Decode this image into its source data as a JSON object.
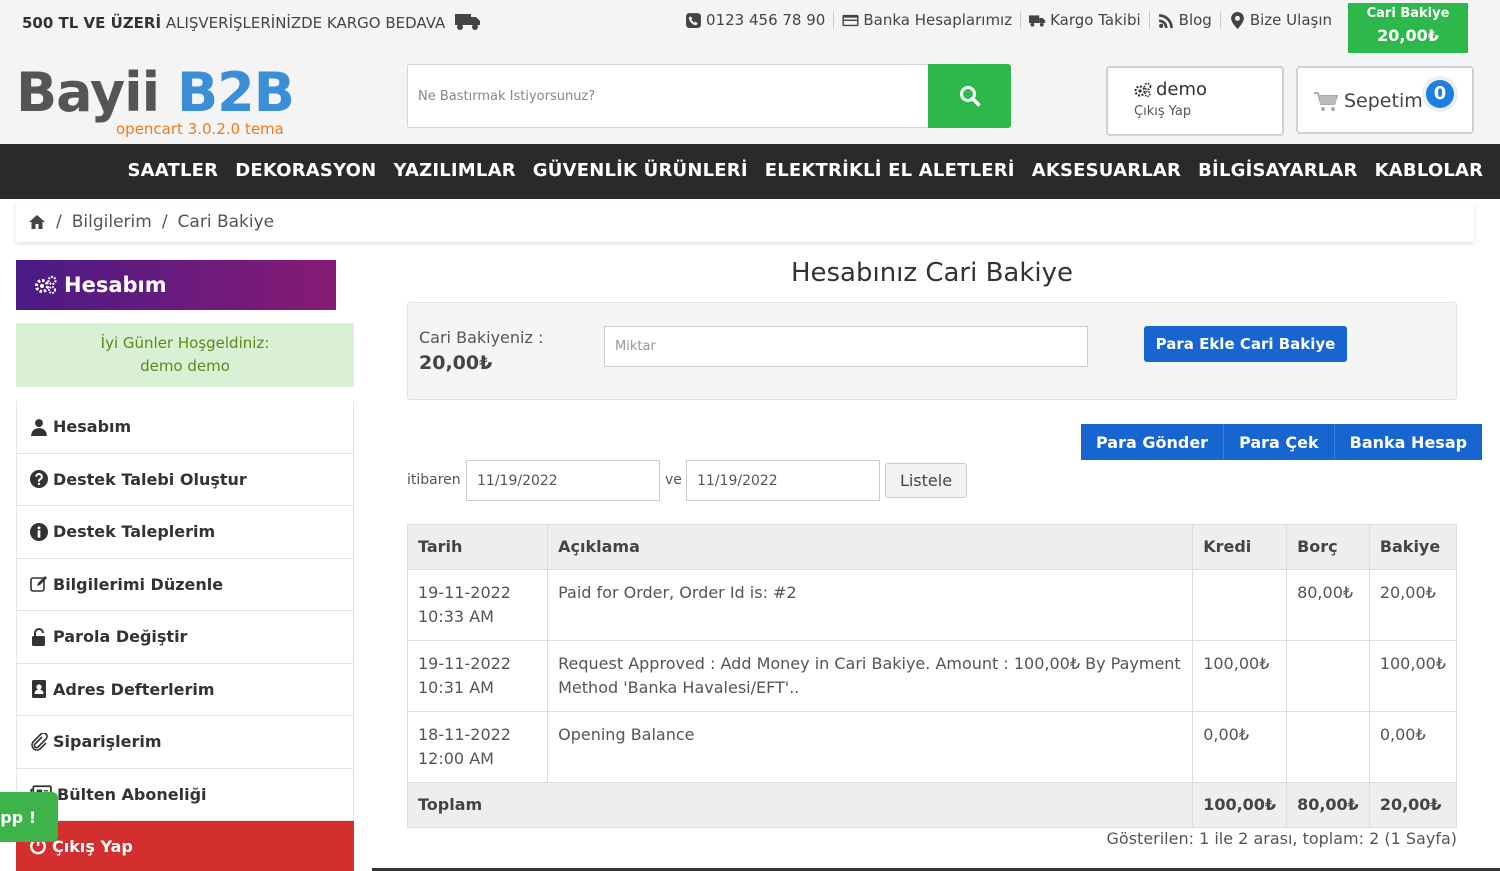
{
  "topbar": {
    "promo_bold": "500 TL VE ÜZERİ",
    "promo_rest": "ALIŞVERİŞLERİNİZDE KARGO BEDAVA",
    "links": [
      {
        "icon": "phone-icon",
        "label": "0123 456 78 90"
      },
      {
        "icon": "credit-card-icon",
        "label": "Banka Hesaplarımız"
      },
      {
        "icon": "truck-icon",
        "label": "Kargo Takibi"
      },
      {
        "icon": "rss-icon",
        "label": "Blog"
      },
      {
        "icon": "map-pin-icon",
        "label": "Bize Ulaşın"
      }
    ],
    "cari_bakiye_label": "Cari Bakiye",
    "cari_bakiye_value": "20,00₺"
  },
  "header": {
    "logo_main": "Bayii",
    "logo_accent": "B2B",
    "logo_sub": "opencart 3.0.2.0 tema",
    "search_placeholder": "Ne Bastırmak İstiyorsunuz?",
    "user_name": "demo",
    "user_logout": "Çıkış Yap",
    "cart_label": "Sepetim",
    "cart_count": "0"
  },
  "nav": [
    "SAATLER",
    "DEKORASYON",
    "YAZILIMLAR",
    "GÜVENLİK ÜRÜNLERİ",
    "ELEKTRİKLİ EL ALETLERİ",
    "AKSESUARLAR",
    "BİLGİSAYARLAR",
    "KABLOLAR"
  ],
  "breadcrumb": [
    "Bilgilerim",
    "Cari Bakiye"
  ],
  "sidebar": {
    "title": "Hesabım",
    "welcome_line1": "İyi Günler Hoşgeldiniz:",
    "welcome_line2": "demo demo",
    "items": [
      {
        "icon": "user-icon",
        "label": "Hesabım"
      },
      {
        "icon": "question-circle-icon",
        "label": "Destek Talebi Oluştur"
      },
      {
        "icon": "info-circle-icon",
        "label": "Destek Taleplerim"
      },
      {
        "icon": "edit-icon",
        "label": "Bilgilerimi Düzenle"
      },
      {
        "icon": "unlock-icon",
        "label": "Parola Değiştir"
      },
      {
        "icon": "address-book-icon",
        "label": "Adres Defterlerim"
      },
      {
        "icon": "paperclip-icon",
        "label": "Siparişlerim"
      },
      {
        "icon": "newspaper-icon",
        "label": "Bülten Aboneliği"
      },
      {
        "icon": "power-icon",
        "label": "Çıkış Yap"
      }
    ],
    "whatsapp_label": "pp !"
  },
  "main": {
    "title": "Hesabınız Cari Bakiye",
    "balance_label": "Cari Bakiyeniz :",
    "balance_value": "20,00₺",
    "amount_placeholder": "Miktar",
    "add_button": "Para Ekle Cari Bakiye",
    "actions": [
      "Para Gönder",
      "Para Çek",
      "Banka Hesap"
    ],
    "filter_from_label": "itibaren",
    "filter_from_value": "11/19/2022",
    "filter_and_label": "ve",
    "filter_to_value": "11/19/2022",
    "list_button": "Listele",
    "table": {
      "headers": [
        "Tarih",
        "Açıklama",
        "Kredi",
        "Borç",
        "Bakiye"
      ],
      "rows": [
        {
          "date": "19-11-2022",
          "time": "10:33 AM",
          "desc": "Paid for Order, Order Id is: #2",
          "kredi": "",
          "borc": "80,00₺",
          "bakiye": "20,00₺"
        },
        {
          "date": "19-11-2022",
          "time": "10:31 AM",
          "desc": "Request Approved : Add Money in Cari Bakiye. Amount : 100,00₺ By Payment Method 'Banka Havalesi/EFT'..",
          "kredi": "100,00₺",
          "borc": "",
          "bakiye": "100,00₺"
        },
        {
          "date": "18-11-2022",
          "time": "12:00 AM",
          "desc": "Opening Balance",
          "kredi": "0,00₺",
          "borc": "",
          "bakiye": "0,00₺"
        }
      ],
      "total_label": "Toplam",
      "total_kredi": "100,00₺",
      "total_borc": "80,00₺",
      "total_bakiye": "20,00₺"
    },
    "page_info": "Gösterilen: 1 ile 2 arası, toplam: 2 (1 Sayfa)"
  },
  "colors": {
    "green": "#2db84b",
    "blue": "#1766cf",
    "nav_bg": "#2a2a2a",
    "purple_start": "#4a1b86",
    "purple_end": "#861b74",
    "red": "#d32f2f"
  }
}
